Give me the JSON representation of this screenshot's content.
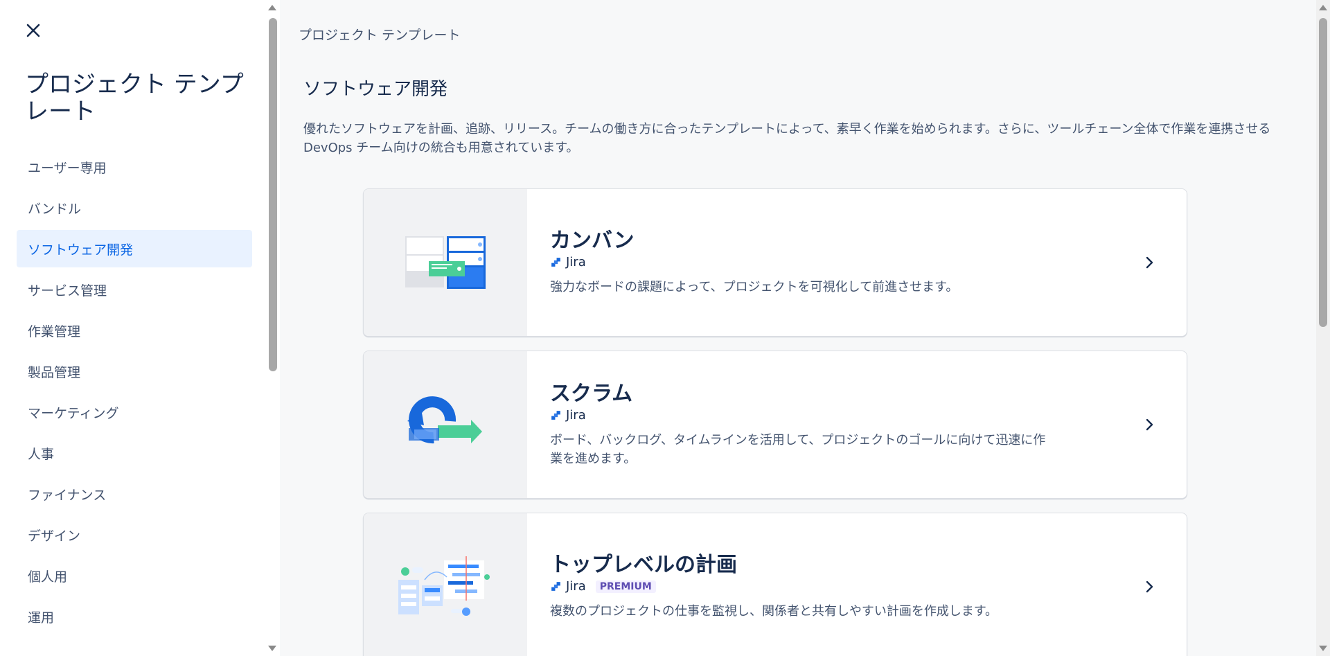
{
  "sidebar": {
    "title": "プロジェクト テンプレート",
    "items": [
      {
        "label": "ユーザー専用",
        "active": false
      },
      {
        "label": "バンドル",
        "active": false
      },
      {
        "label": "ソフトウェア開発",
        "active": true
      },
      {
        "label": "サービス管理",
        "active": false
      },
      {
        "label": "作業管理",
        "active": false
      },
      {
        "label": "製品管理",
        "active": false
      },
      {
        "label": "マーケティング",
        "active": false
      },
      {
        "label": "人事",
        "active": false
      },
      {
        "label": "ファイナンス",
        "active": false
      },
      {
        "label": "デザイン",
        "active": false
      },
      {
        "label": "個人用",
        "active": false
      },
      {
        "label": "運用",
        "active": false
      }
    ]
  },
  "main": {
    "breadcrumb": "プロジェクト テンプレート",
    "title": "ソフトウェア開発",
    "description": "優れたソフトウェアを計画、追跡、リリース。チームの働き方に合ったテンプレートによって、素早く作業を始められます。さらに、ツールチェーン全体で作業を連携させる DevOps チーム向けの統合も用意されています。",
    "cards": [
      {
        "title": "カンバン",
        "product": "Jira",
        "badge": "",
        "description": "強力なボードの課題によって、プロジェクトを可視化して前進させます。",
        "art": "kanban-board-illustration"
      },
      {
        "title": "スクラム",
        "product": "Jira",
        "badge": "",
        "description": "ボード、バックログ、タイムラインを活用して、プロジェクトのゴールに向けて迅速に作業を進めます。",
        "art": "scrum-cycle-illustration"
      },
      {
        "title": "トップレベルの計画",
        "product": "Jira",
        "badge": "PREMIUM",
        "description": "複数のプロジェクトの仕事を監視し、関係者と共有しやすい計画を作成します。",
        "art": "top-level-plan-illustration"
      }
    ]
  },
  "colors": {
    "accent": "#0c66e4",
    "active_bg": "#e9f2ff",
    "main_bg": "#f7f8f9",
    "jira_blue": "#1868db"
  },
  "icons": {
    "close": "close-icon",
    "chevron": "chevron-right-icon",
    "jira": "jira-logo-icon"
  }
}
